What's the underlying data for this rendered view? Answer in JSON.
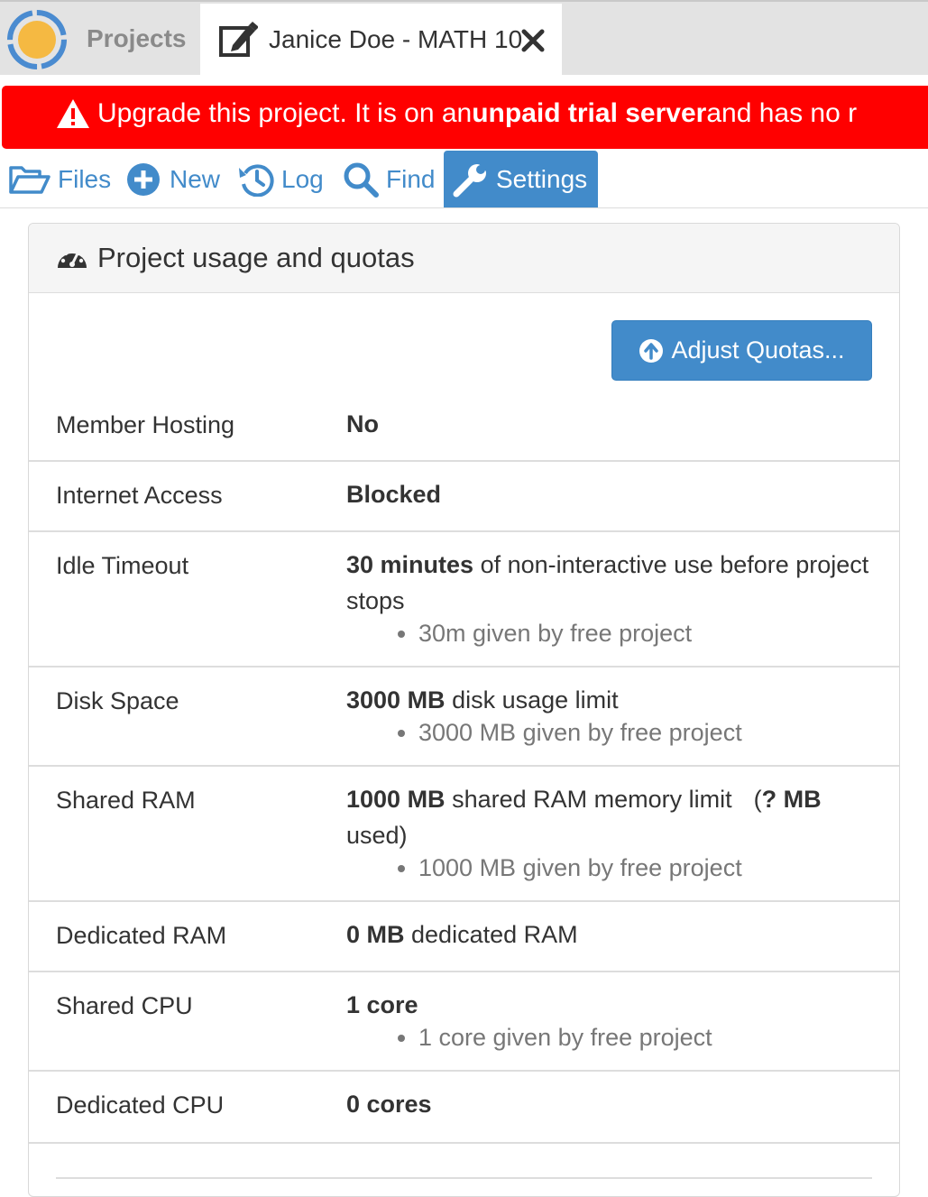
{
  "top_tabs": {
    "projects_label": "Projects",
    "file_tab_label": "Janice Doe - MATH 10"
  },
  "banner": {
    "part1": "Upgrade this project. It is on an ",
    "bold": "unpaid trial server",
    "part2": " and has no r"
  },
  "nav": {
    "files": "Files",
    "new": "New",
    "log": "Log",
    "find": "Find",
    "settings": "Settings"
  },
  "panel": {
    "title": "Project usage and quotas",
    "adjust_button": "Adjust Quotas..."
  },
  "quotas": {
    "member_hosting": {
      "label": "Member Hosting",
      "value": "No"
    },
    "internet_access": {
      "label": "Internet Access",
      "value": "Blocked"
    },
    "idle_timeout": {
      "label": "Idle Timeout",
      "bold": "30 minutes",
      "text": " of non-interactive use before project stops",
      "detail": "30m given by free project"
    },
    "disk_space": {
      "label": "Disk Space",
      "bold": "3000 MB",
      "text": " disk usage limit",
      "detail": "3000 MB given by free project"
    },
    "shared_ram": {
      "label": "Shared RAM",
      "bold": "1000 MB",
      "text": " shared RAM memory limit",
      "used_open": "(",
      "used_bold": "? MB",
      "used_close": " used)",
      "detail": "1000 MB given by free project"
    },
    "dedicated_ram": {
      "label": "Dedicated RAM",
      "bold": "0 MB",
      "text": " dedicated RAM"
    },
    "shared_cpu": {
      "label": "Shared CPU",
      "bold": "1 core",
      "detail": "1 core given by free project"
    },
    "dedicated_cpu": {
      "label": "Dedicated CPU",
      "bold": "0 cores"
    }
  },
  "colors": {
    "accent": "#428bca",
    "banner": "#ff0000",
    "logo_ring": "#4a8bd0",
    "logo_core": "#f5b942"
  }
}
